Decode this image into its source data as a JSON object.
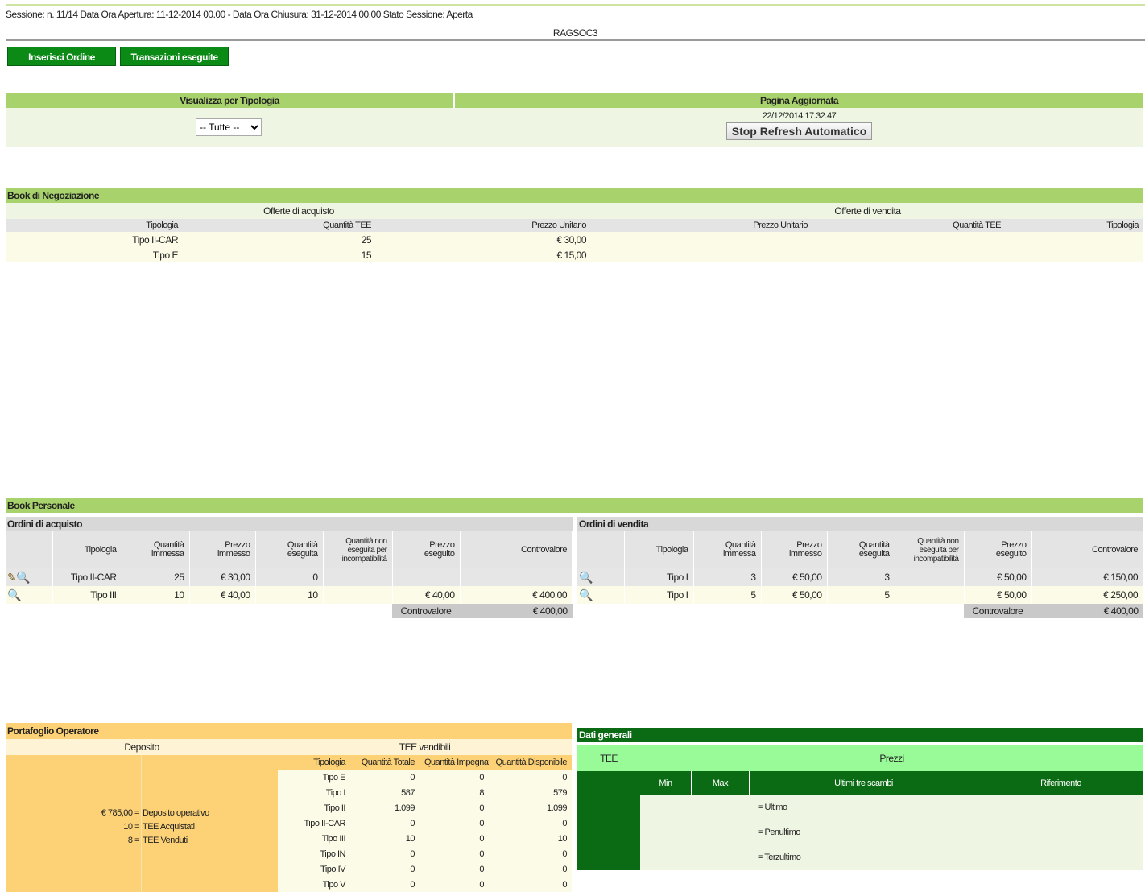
{
  "header": {
    "session_line": "Sessione: n. 11/14 Data Ora Apertura: 11-12-2014 00.00  - Data Ora Chiusura: 31-12-2014 00.00 Stato Sessione: Aperta",
    "company": "RAGSOC3"
  },
  "buttons": {
    "insert_order": "Inserisci Ordine",
    "transactions": "Transazioni eseguite"
  },
  "filter": {
    "type_label": "Visualizza per Tipologia",
    "type_selected": "-- Tutte --",
    "updated_label": "Pagina Aggiornata",
    "updated_value": "22/12/2014 17.32.47",
    "stop_refresh": "Stop Refresh Automatico"
  },
  "book_negoziazione": {
    "title": "Book di Negoziazione",
    "buy_title": "Offerte di acquisto",
    "sell_title": "Offerte di vendita",
    "buy_headers": [
      "Tipologia",
      "Quantità TEE",
      "Prezzo Unitario"
    ],
    "sell_headers": [
      "Prezzo Unitario",
      "Quantità TEE",
      "Tipologia"
    ],
    "rows": [
      {
        "tipologia": "Tipo II-CAR",
        "quantita": "25",
        "prezzo": "€ 30,00"
      },
      {
        "tipologia": "Tipo E",
        "quantita": "15",
        "prezzo": "€ 15,00"
      }
    ]
  },
  "book_personale": {
    "title": "Book Personale",
    "buy": {
      "title": "Ordini di acquisto",
      "headers": [
        "Tipologia",
        "Quantità immessa",
        "Prezzo immesso",
        "Quantità eseguita",
        "Quantità non eseguita per incompatibilità",
        "Prezzo eseguito",
        "Controvalore"
      ],
      "rows": [
        {
          "icons": "edit-view",
          "tipologia": "Tipo II-CAR",
          "q_immessa": "25",
          "p_immesso": "€ 30,00",
          "q_eseguita": "0",
          "q_non": "",
          "p_eseguito": "",
          "controvalore": ""
        },
        {
          "icons": "view",
          "tipologia": "Tipo III",
          "q_immessa": "10",
          "p_immesso": "€ 40,00",
          "q_eseguita": "10",
          "q_non": "",
          "p_eseguito": "€ 40,00",
          "controvalore": "€ 400,00"
        }
      ],
      "total_label": "Controvalore",
      "total_value": "€ 400,00"
    },
    "sell": {
      "title": "Ordini di vendita",
      "headers": [
        "Tipologia",
        "Quantità immessa",
        "Prezzo immesso",
        "Quantità eseguita",
        "Quantità non eseguita per incompatibilità",
        "Prezzo eseguito",
        "Controvalore"
      ],
      "rows": [
        {
          "icons": "view",
          "tipologia": "Tipo I",
          "q_immessa": "3",
          "p_immesso": "€ 50,00",
          "q_eseguita": "3",
          "q_non": "",
          "p_eseguito": "€ 50,00",
          "controvalore": "€ 150,00"
        },
        {
          "icons": "view",
          "tipologia": "Tipo I",
          "q_immessa": "5",
          "p_immesso": "€ 50,00",
          "q_eseguita": "5",
          "q_non": "",
          "p_eseguito": "€ 50,00",
          "controvalore": "€ 250,00"
        }
      ],
      "total_label": "Controvalore",
      "total_value": "€ 400,00"
    }
  },
  "portafoglio": {
    "title": "Portafoglio Operatore",
    "deposito_title": "Deposito",
    "tee_title": "TEE vendibili",
    "deposito_lines": [
      {
        "value": "€ 785,00 =",
        "label": "Deposito operativo"
      },
      {
        "value": "10 =",
        "label": "TEE Acquistati"
      },
      {
        "value": "8 =",
        "label": "TEE Venduti"
      }
    ],
    "tee_headers": [
      "Tipologia",
      "Quantità Totale",
      "Quantità Impegnata",
      "Quantità Disponibile"
    ],
    "tee_rows": [
      {
        "tipologia": "Tipo E",
        "totale": "0",
        "impegnata": "0",
        "disponibile": "0"
      },
      {
        "tipologia": "Tipo I",
        "totale": "587",
        "impegnata": "8",
        "disponibile": "579"
      },
      {
        "tipologia": "Tipo II",
        "totale": "1.099",
        "impegnata": "0",
        "disponibile": "1.099"
      },
      {
        "tipologia": "Tipo II-CAR",
        "totale": "0",
        "impegnata": "0",
        "disponibile": "0"
      },
      {
        "tipologia": "Tipo III",
        "totale": "10",
        "impegnata": "0",
        "disponibile": "10"
      },
      {
        "tipologia": "Tipo IN",
        "totale": "0",
        "impegnata": "0",
        "disponibile": "0"
      },
      {
        "tipologia": "Tipo IV",
        "totale": "0",
        "impegnata": "0",
        "disponibile": "0"
      },
      {
        "tipologia": "Tipo V",
        "totale": "0",
        "impegnata": "0",
        "disponibile": "0"
      }
    ]
  },
  "dati_generali": {
    "title": "Dati generali",
    "tee_label": "TEE",
    "prezzi_label": "Prezzi",
    "cols": [
      "Min",
      "Max",
      "Ultimi tre scambi",
      "Riferimento"
    ],
    "scambi": [
      "= Ultimo",
      "= Penultimo",
      "= Terzultimo"
    ]
  },
  "colors": {
    "green_band": "#a8d26c",
    "dark_green": "#0b6b14",
    "button_green": "#0b8a16",
    "orange": "#fdd276"
  }
}
